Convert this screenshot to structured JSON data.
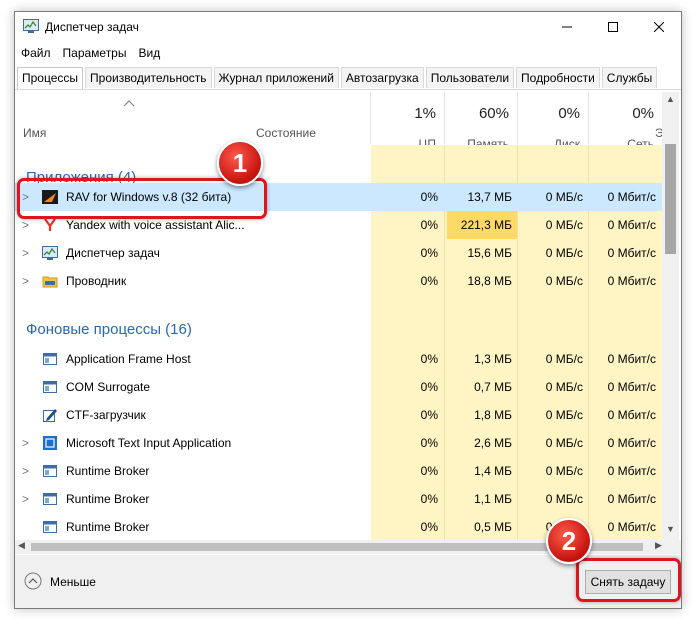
{
  "window": {
    "title": "Диспетчер задач"
  },
  "menu": [
    "Файл",
    "Параметры",
    "Вид"
  ],
  "tabs": [
    "Процессы",
    "Производительность",
    "Журнал приложений",
    "Автозагрузка",
    "Пользователи",
    "Подробности",
    "Службы"
  ],
  "columns": {
    "name": "Имя",
    "state": "Состояние",
    "cpu": {
      "pct": "1%",
      "label": "ЦП"
    },
    "memory": {
      "pct": "60%",
      "label": "Память"
    },
    "disk": {
      "pct": "0%",
      "label": "Диск"
    },
    "network": {
      "pct": "0%",
      "label": "Сеть"
    },
    "cut_col": "Э"
  },
  "groups": {
    "apps": "Приложения (4)",
    "background": "Фоновые процессы (16)"
  },
  "rows": [
    {
      "name": "RAV for Windows v.8 (32 бита)",
      "cpu": "0%",
      "mem": "13,7 МБ",
      "disk": "0 МБ/с",
      "net": "0 Мбит/с"
    },
    {
      "name": "Yandex with voice assistant Alic...",
      "cpu": "0%",
      "mem": "221,3 МБ",
      "disk": "0 МБ/с",
      "net": "0 Мбит/с"
    },
    {
      "name": "Диспетчер задач",
      "cpu": "0%",
      "mem": "15,6 МБ",
      "disk": "0 МБ/с",
      "net": "0 Мбит/с"
    },
    {
      "name": "Проводник",
      "cpu": "0%",
      "mem": "18,8 МБ",
      "disk": "0 МБ/с",
      "net": "0 Мбит/с"
    },
    {
      "name": "Application Frame Host",
      "cpu": "0%",
      "mem": "1,3 МБ",
      "disk": "0 МБ/с",
      "net": "0 Мбит/с"
    },
    {
      "name": "COM Surrogate",
      "cpu": "0%",
      "mem": "0,7 МБ",
      "disk": "0 МБ/с",
      "net": "0 Мбит/с"
    },
    {
      "name": "CTF-загрузчик",
      "cpu": "0%",
      "mem": "1,8 МБ",
      "disk": "0 МБ/с",
      "net": "0 Мбит/с"
    },
    {
      "name": "Microsoft Text Input Application",
      "cpu": "0%",
      "mem": "2,6 МБ",
      "disk": "0 МБ/с",
      "net": "0 Мбит/с"
    },
    {
      "name": "Runtime Broker",
      "cpu": "0%",
      "mem": "1,4 МБ",
      "disk": "0 МБ/с",
      "net": "0 Мбит/с"
    },
    {
      "name": "Runtime Broker",
      "cpu": "0%",
      "mem": "1,1 МБ",
      "disk": "0 МБ/с",
      "net": "0 Мбит/с"
    },
    {
      "name": "Runtime Broker",
      "cpu": "0%",
      "mem": "0,5 МБ",
      "disk": "0 МБ/с",
      "net": "0 Мбит/с"
    }
  ],
  "footer": {
    "less": "Меньше",
    "end_task": "Снять задачу"
  },
  "annotations": {
    "badge1": "1",
    "badge2": "2"
  },
  "colors": {
    "accent_red": "#e0141e",
    "group_blue": "#2a68b8",
    "selection": "#cce8ff",
    "usage_bg": "#fff4c4",
    "usage_hi": "#ffd966"
  }
}
